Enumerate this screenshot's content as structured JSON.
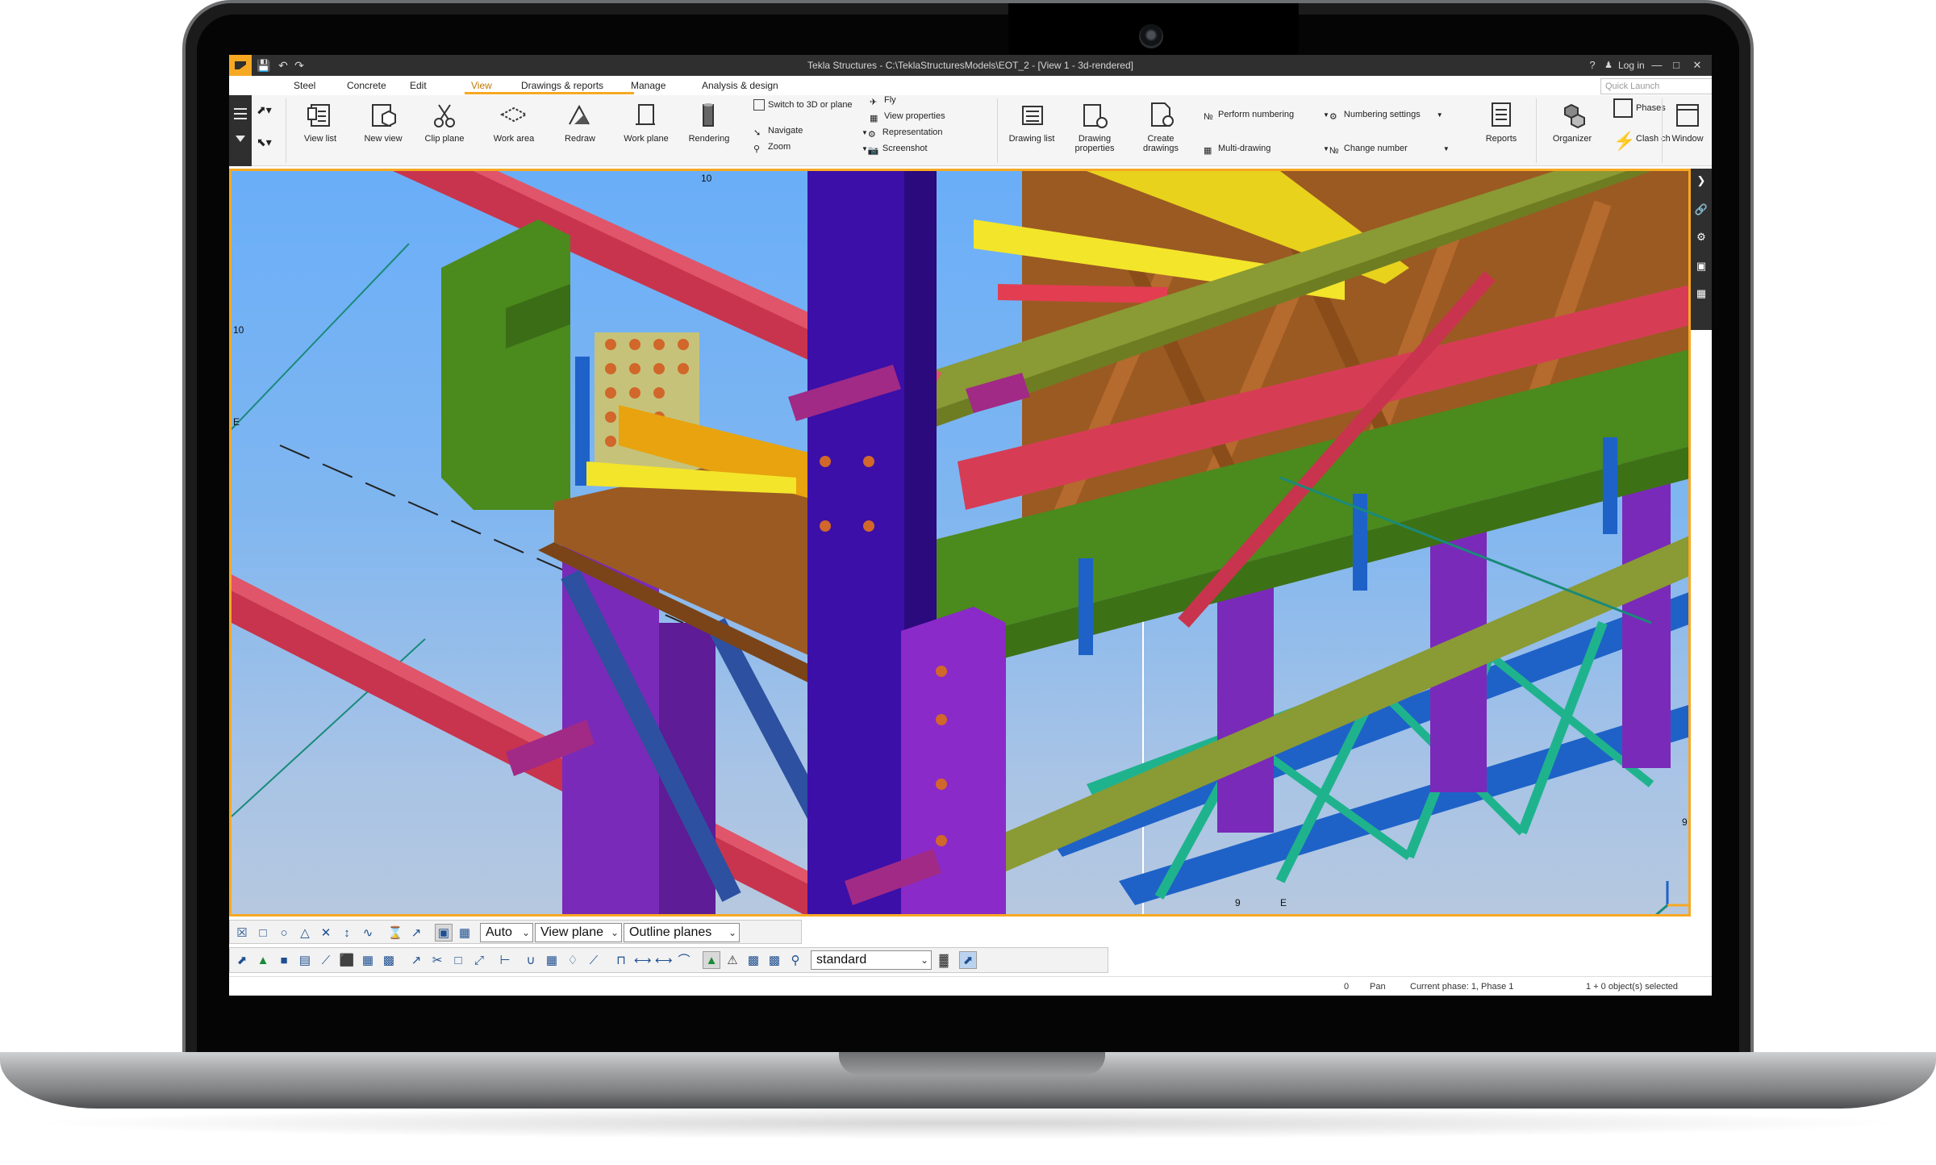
{
  "window": {
    "title": "Tekla Structures - C:\\TeklaStructuresModels\\EOT_2 - [View 1 - 3d-rendered]",
    "help": "?",
    "login": "Log in"
  },
  "menu": {
    "items": [
      "Steel",
      "Concrete",
      "Edit",
      "View",
      "Drawings & reports",
      "Manage",
      "Analysis & design"
    ],
    "active": "View"
  },
  "quick_launch": {
    "placeholder": "Quick Launch"
  },
  "ribbon": {
    "view_list": "View list",
    "new_view": "New view",
    "clip_plane": "Clip plane",
    "work_area": "Work area",
    "redraw": "Redraw",
    "work_plane": "Work plane",
    "rendering": "Rendering",
    "switch_3d": "Switch to 3D or plane",
    "navigate": "Navigate",
    "zoom": "Zoom",
    "fly": "Fly",
    "view_properties": "View properties",
    "representation": "Representation",
    "screenshot": "Screenshot",
    "drawing_list": "Drawing list",
    "drawing_properties_1": "Drawing",
    "drawing_properties_2": "properties",
    "create_drawings_1": "Create",
    "create_drawings_2": "drawings",
    "perform_numbering": "Perform numbering",
    "multi_drawing": "Multi-drawing",
    "numbering_settings": "Numbering settings",
    "change_number": "Change number",
    "reports": "Reports",
    "organizer": "Organizer",
    "phases": "Phases",
    "clash_check": "Clash ch",
    "window": "Window"
  },
  "viewport": {
    "grid_labels": [
      "10",
      "10",
      "E",
      "9",
      "E",
      "9"
    ]
  },
  "toolbar1": {
    "combo_auto": "Auto",
    "combo_view_plane": "View plane",
    "combo_outline": "Outline planes"
  },
  "toolbar2": {
    "combo_standard": "standard"
  },
  "status": {
    "count": "0",
    "mode": "Pan",
    "phase": "Current phase: 1, Phase 1",
    "selected": "1 + 0 object(s) selected"
  },
  "colors": {
    "accent": "#f7a823",
    "titlebar": "#2f2f2f",
    "sky": "#6aaef8",
    "column_purple": "#3b0fa8",
    "beam_red": "#c8344d",
    "beam_green": "#4b8a1c",
    "beam_brown": "#9b5a22",
    "brace_teal": "#1fb38d",
    "brace_blue": "#1e62c8"
  },
  "icons": [
    "app-logo-icon",
    "save-icon",
    "undo-icon",
    "redo-icon",
    "help-icon",
    "user-icon",
    "minimize-icon",
    "maximize-icon",
    "close-icon",
    "search-icon",
    "menu-hamburger-icon",
    "pointer-icon",
    "chevron-right-icon",
    "link-icon",
    "gear-icon",
    "cube-icon"
  ]
}
